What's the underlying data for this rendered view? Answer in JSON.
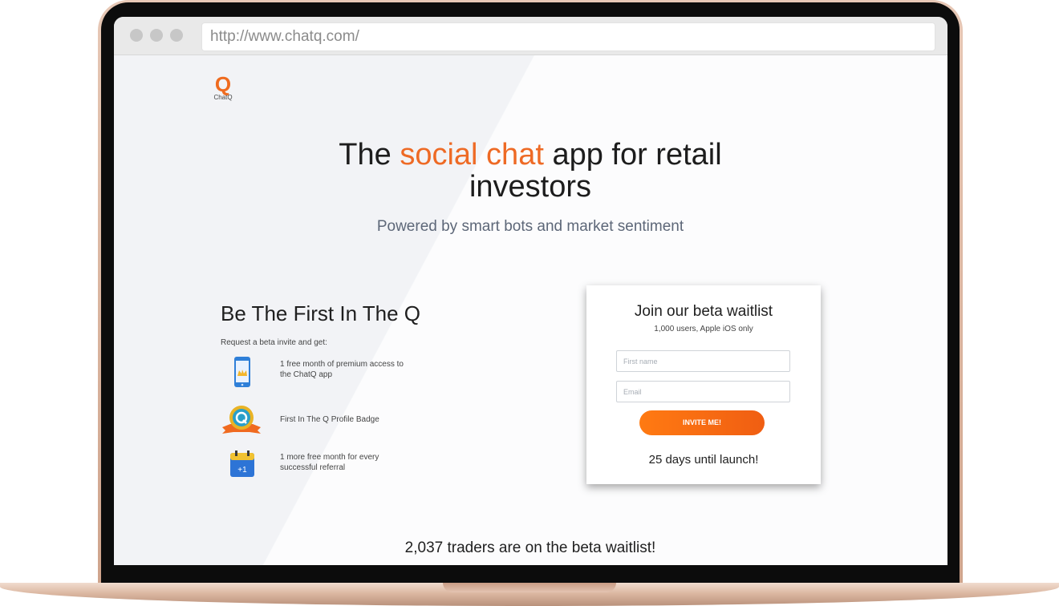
{
  "browser": {
    "url": "http://www.chatq.com/"
  },
  "logo": {
    "letter": "Q",
    "name": "ChatQ"
  },
  "hero": {
    "title_before": "The ",
    "title_accent": "social chat",
    "title_after": " app for retail investors",
    "subtitle": "Powered by smart bots and market sentiment"
  },
  "benefits_section": {
    "title": "Be The First In The Q",
    "lead": "Request a beta invite and get:",
    "items": [
      {
        "icon": "phone-crown-icon",
        "text": "1 free month of premium access to the ChatQ app"
      },
      {
        "icon": "q-badge-icon",
        "text": "First In The Q Profile Badge"
      },
      {
        "icon": "calendar-plus-one-icon",
        "text": "1 more free month for every successful referral",
        "badge": "+1"
      }
    ]
  },
  "signup_card": {
    "title": "Join our beta waitlist",
    "subtitle": "1,000 users, Apple iOS only",
    "first_name_placeholder": "First name",
    "email_placeholder": "Email",
    "button_label": "INVITE ME!",
    "countdown": "25 days until launch!"
  },
  "waitlist_count": "2,037 traders are on the beta waitlist!",
  "colors": {
    "accent": "#ee6a25",
    "button_start": "#ff7a12",
    "button_end": "#f05e12",
    "subtitle": "#5d6778"
  }
}
